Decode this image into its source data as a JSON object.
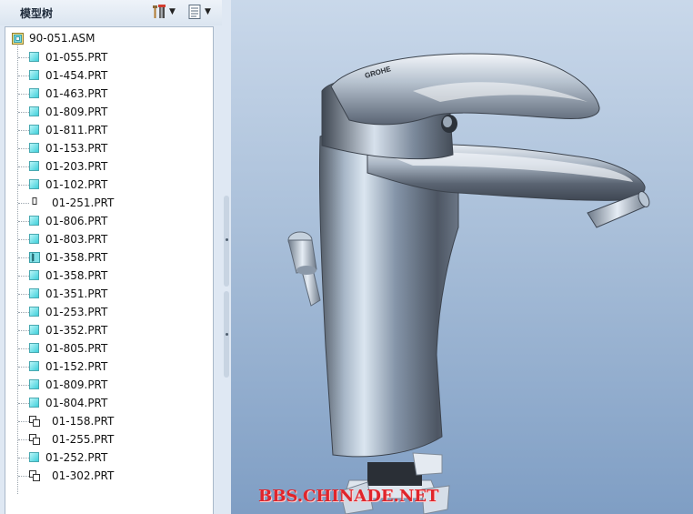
{
  "panel": {
    "title": "模型树",
    "settings_icon": "tools-icon",
    "show_icon": "list-icon"
  },
  "tree": {
    "root": "90-051.ASM",
    "items": [
      {
        "label": "01-055.PRT",
        "icon": "part-icon"
      },
      {
        "label": "01-454.PRT",
        "icon": "part-icon"
      },
      {
        "label": "01-463.PRT",
        "icon": "part-icon"
      },
      {
        "label": "01-809.PRT",
        "icon": "part-icon"
      },
      {
        "label": "01-811.PRT",
        "icon": "part-icon"
      },
      {
        "label": "01-153.PRT",
        "icon": "part-icon"
      },
      {
        "label": "01-203.PRT",
        "icon": "part-icon"
      },
      {
        "label": "01-102.PRT",
        "icon": "part-icon"
      },
      {
        "label": "01-251.PRT",
        "icon": "missing-part-icon"
      },
      {
        "label": "01-806.PRT",
        "icon": "part-icon"
      },
      {
        "label": "01-803.PRT",
        "icon": "part-icon"
      },
      {
        "label": "01-358.PRT",
        "icon": "spring-part-icon"
      },
      {
        "label": "01-358.PRT",
        "icon": "part-icon"
      },
      {
        "label": "01-351.PRT",
        "icon": "part-icon"
      },
      {
        "label": "01-253.PRT",
        "icon": "part-icon"
      },
      {
        "label": "01-352.PRT",
        "icon": "part-icon"
      },
      {
        "label": "01-805.PRT",
        "icon": "part-icon"
      },
      {
        "label": "01-152.PRT",
        "icon": "part-icon"
      },
      {
        "label": "01-809.PRT",
        "icon": "part-icon"
      },
      {
        "label": "01-804.PRT",
        "icon": "part-icon"
      },
      {
        "label": "01-158.PRT",
        "icon": "linked-part-icon"
      },
      {
        "label": "01-255.PRT",
        "icon": "linked-part-icon"
      },
      {
        "label": "01-252.PRT",
        "icon": "part-icon"
      },
      {
        "label": "01-302.PRT",
        "icon": "linked-part-icon"
      }
    ]
  },
  "viewport": {
    "watermark": "BBS.CHINADE.NET",
    "logo_text": "GROHE"
  },
  "colors": {
    "panel_bg": "#dfe8f3",
    "part_icon": "#3fd0da",
    "viewport_bg_top": "#c9d8ea",
    "viewport_bg_bottom": "#7f9ec4",
    "watermark": "#e0252b"
  }
}
